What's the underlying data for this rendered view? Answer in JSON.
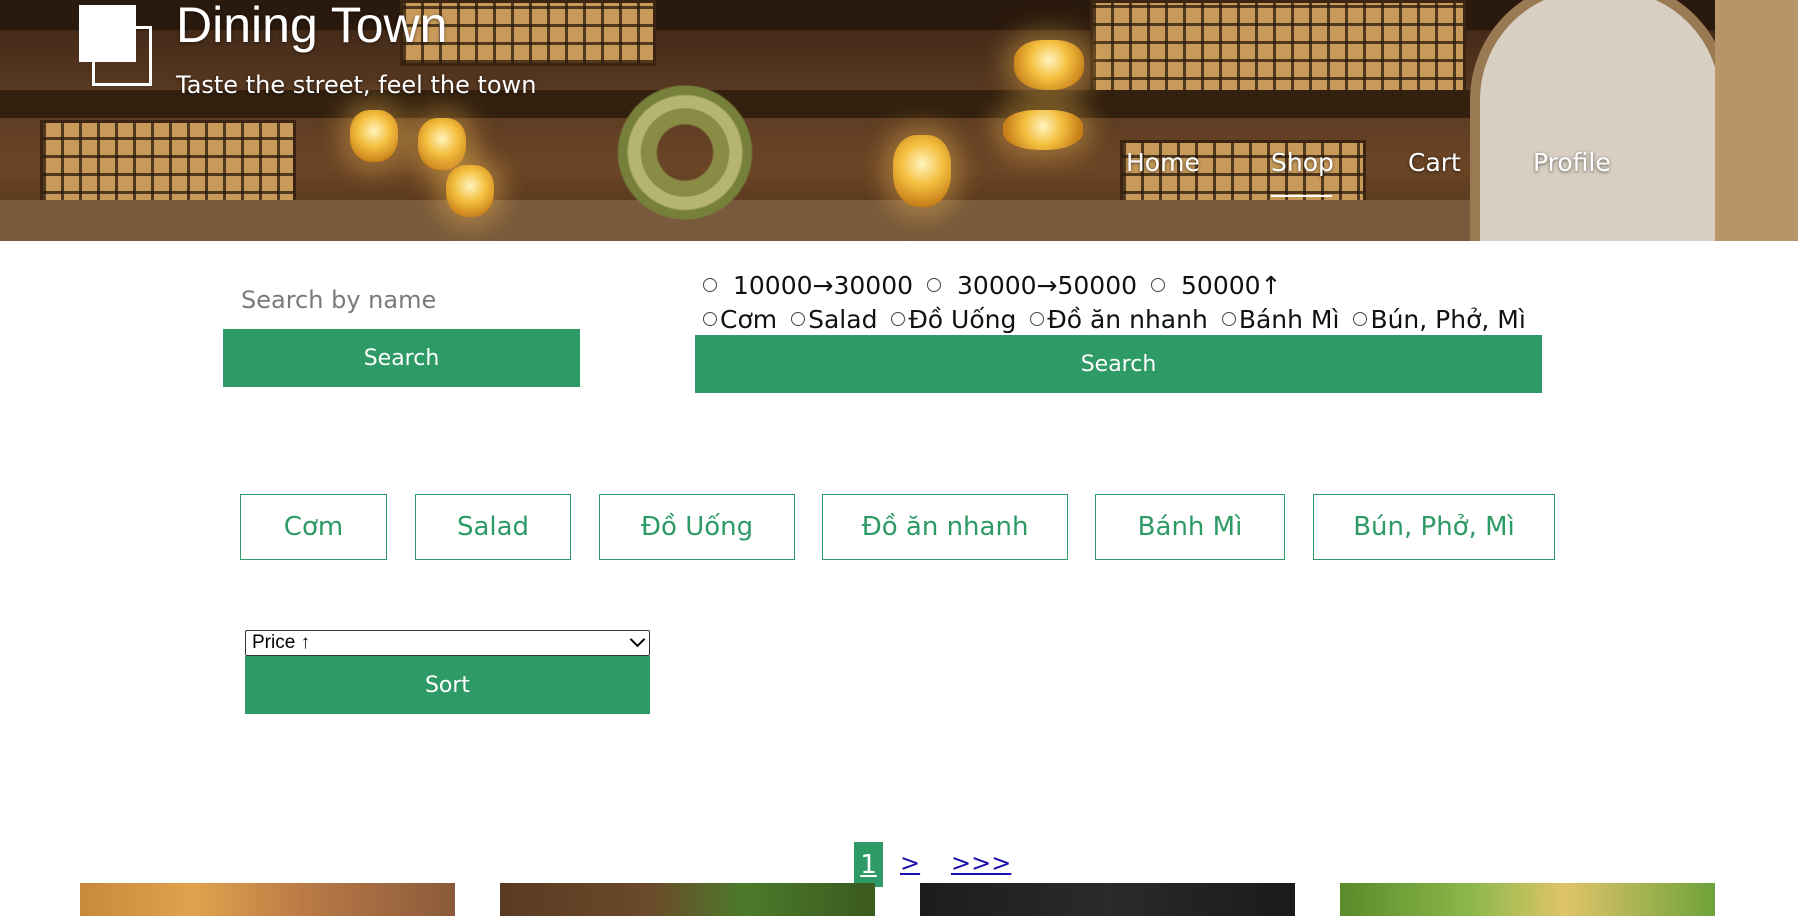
{
  "header": {
    "title": "Dining Town",
    "tagline": "Taste the street, feel the town"
  },
  "nav": {
    "items": [
      {
        "label": "Home"
      },
      {
        "label": "Shop",
        "active": true
      },
      {
        "label": "Cart"
      },
      {
        "label": "Profile"
      }
    ]
  },
  "search": {
    "placeholder": "Search by name",
    "value": "",
    "button_label": "Search"
  },
  "filters": {
    "price_ranges": [
      "10000→30000",
      "30000→50000",
      "50000↑"
    ],
    "categories": [
      "Cơm",
      "Salad",
      "Đồ Uống",
      "Đồ ăn nhanh",
      "Bánh Mì",
      "Bún, Phở, Mì"
    ],
    "button_label": "Search"
  },
  "category_buttons": [
    "Cơm",
    "Salad",
    "Đồ Uống",
    "Đồ ăn nhanh",
    "Bánh Mì",
    "Bún, Phở, Mì"
  ],
  "sort": {
    "selected": "Price ↑",
    "button_label": "Sort"
  },
  "pagination": {
    "current": "1",
    "next": ">",
    "last": ">>>"
  },
  "colors": {
    "accent": "#2e9a66",
    "link": "#1a0dab"
  }
}
